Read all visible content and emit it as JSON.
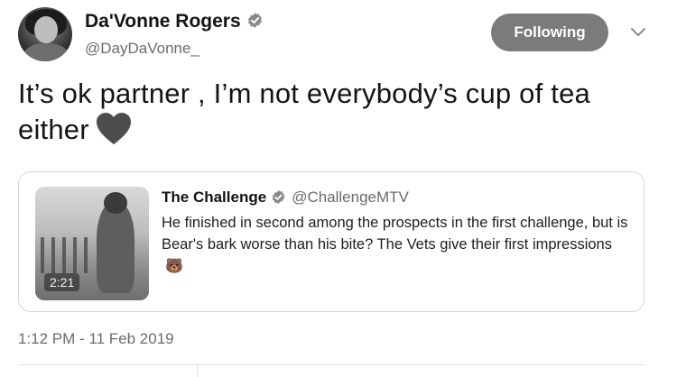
{
  "author": {
    "display_name": "Da'Vonne Rogers",
    "handle": "@DayDaVonne_",
    "verified_icon": "verified-badge-icon",
    "avatar_icon": "avatar-photo"
  },
  "actions": {
    "follow_label": "Following",
    "more_icon": "chevron-down-icon"
  },
  "tweet": {
    "text": "It’s ok partner , I’m not everybody’s cup of tea either",
    "emoji_icon": "heart-icon",
    "timestamp": "1:12 PM - 11 Feb 2019"
  },
  "quoted": {
    "name": "The Challenge",
    "handle": "@ChallengeMTV",
    "text": "He finished in second among the prospects in the first challenge, but is Bear's bark worse than his bite? The Vets give their first impressions",
    "emoji": "🐻",
    "video_duration": "2:21",
    "verified_icon": "verified-badge-icon"
  },
  "colors": {
    "follow_button_bg": "#7b7b7b",
    "text": "#141414",
    "muted": "#6b6b6b"
  }
}
